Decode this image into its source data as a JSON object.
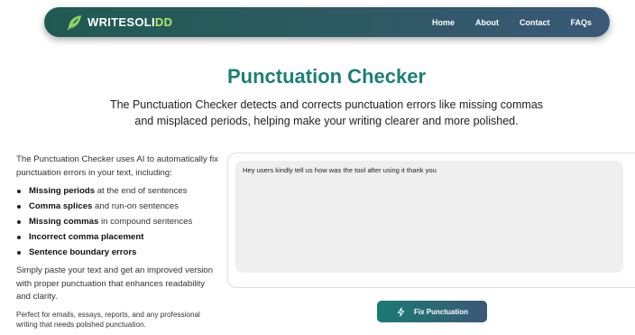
{
  "brand": {
    "name_main": "WRITESOLI",
    "name_accent": "DD",
    "accent_color": "#b9e36a"
  },
  "nav": {
    "items": [
      "Home",
      "About",
      "Contact",
      "FAQs"
    ]
  },
  "hero": {
    "title": "Punctuation Checker",
    "subtitle": "The Punctuation Checker detects and corrects punctuation errors like missing commas and misplaced periods, helping make your writing clearer and more polished."
  },
  "info": {
    "intro": "The Punctuation Checker uses AI to automatically fix punctuation errors in your text, including:",
    "features": [
      {
        "bold": "Missing periods",
        "rest": " at the end of sentences"
      },
      {
        "bold": "Comma splices",
        "rest": " and run-on sentences"
      },
      {
        "bold": "Missing commas",
        "rest": " in compound sentences"
      },
      {
        "bold": "Incorrect comma placement",
        "rest": ""
      },
      {
        "bold": "Sentence boundary errors",
        "rest": ""
      }
    ],
    "outro": "Simply paste your text and get an improved version with proper punctuation that enhances readability and clarity.",
    "note": "Perfect for emails, essays, reports, and any professional writing that needs polished punctuation."
  },
  "editor": {
    "value": "Hey users kindly tell us how was the tool after using it thank you"
  },
  "action": {
    "fix_label": "Fix Punctuation",
    "icon": "lightning-icon"
  },
  "colors": {
    "title": "#1c7f77",
    "nav_gradient_start": "#1f5a52",
    "nav_gradient_end": "#3a5878"
  }
}
